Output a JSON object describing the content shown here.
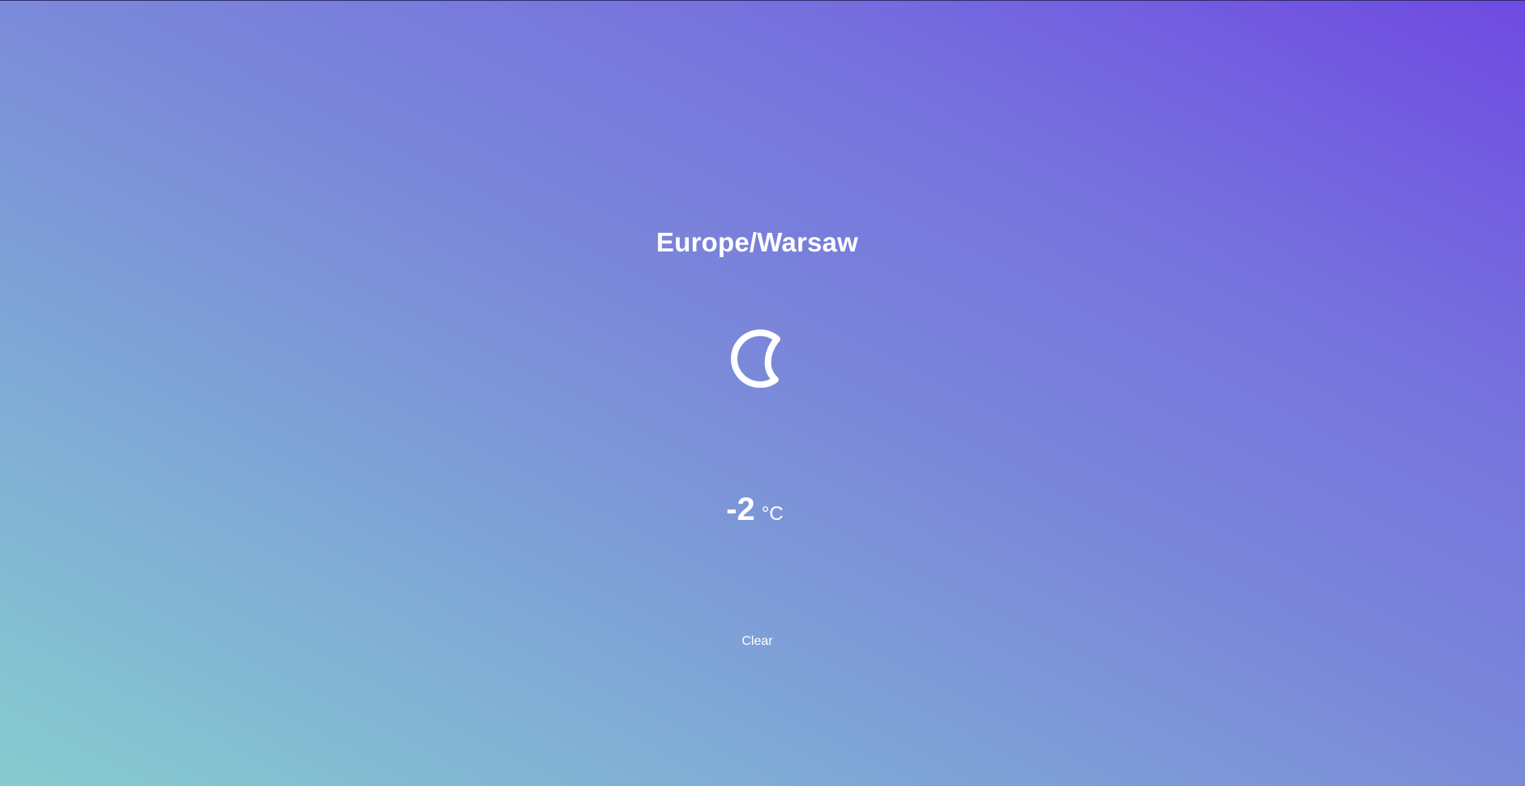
{
  "location": "Europe/Warsaw",
  "icon": "moon-icon",
  "temperature": {
    "value": "-2",
    "unit": "°C"
  },
  "condition": "Clear",
  "colors": {
    "gradient_start": "#86cccf",
    "gradient_end": "#6f4ae2",
    "text": "#ffffff"
  }
}
